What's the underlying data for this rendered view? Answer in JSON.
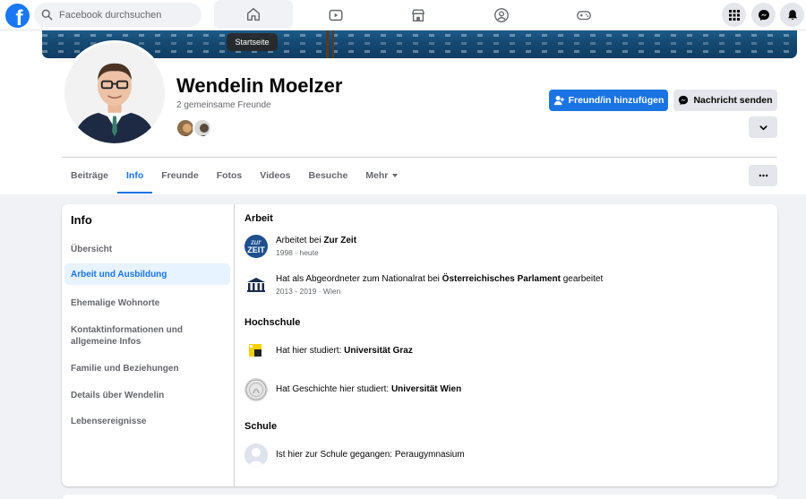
{
  "search": {
    "placeholder": "Facebook durchsuchen"
  },
  "nav": {
    "tooltip": "Startseite",
    "tabs": [
      {
        "icon": "home-icon"
      },
      {
        "icon": "watch-icon"
      },
      {
        "icon": "marketplace-icon"
      },
      {
        "icon": "groups-icon"
      },
      {
        "icon": "gaming-icon"
      }
    ],
    "right": [
      "menu-grid-icon",
      "messenger-icon",
      "notifications-icon"
    ]
  },
  "profile": {
    "name": "Wendelin Moelzer",
    "mutual_friends": "2 gemeinsame Freunde",
    "add_friend": "Freund/in hinzufügen",
    "send_message": "Nachricht senden"
  },
  "tabs": [
    {
      "label": "Beiträge"
    },
    {
      "label": "Info"
    },
    {
      "label": "Freunde"
    },
    {
      "label": "Fotos"
    },
    {
      "label": "Videos"
    },
    {
      "label": "Besuche"
    },
    {
      "label": "Mehr"
    }
  ],
  "sidebar": {
    "title": "Info",
    "items": [
      {
        "label": "Übersicht"
      },
      {
        "label": "Arbeit und Ausbildung"
      },
      {
        "label": "Ehemalige Wohnorte"
      },
      {
        "label": "Kontaktinformationen und allgemeine Infos"
      },
      {
        "label": "Familie und Beziehungen"
      },
      {
        "label": "Details über Wendelin"
      },
      {
        "label": "Lebensereignisse"
      }
    ]
  },
  "work": {
    "title": "Arbeit",
    "items": [
      {
        "prefix": "Arbeitet bei ",
        "org": "Zur Zeit",
        "suffix": "",
        "sub": "1998 - heute"
      },
      {
        "prefix": "Hat als Abgeordneter zum Nationalrat bei ",
        "org": "Österreichisches Parlament",
        "suffix": " gearbeitet",
        "sub": "2013 - 2019 · Wien"
      }
    ]
  },
  "college": {
    "title": "Hochschule",
    "items": [
      {
        "prefix": "Hat hier studiert: ",
        "org": "Universität Graz"
      },
      {
        "prefix": "Hat Geschichte hier studiert: ",
        "org": "Universität Wien"
      }
    ]
  },
  "school": {
    "title": "Schule",
    "items": [
      {
        "prefix": "Ist hier zur Schule gegangen: ",
        "org": "Peraugymnasium"
      }
    ]
  },
  "logos": {
    "zurzeit_line1": "zur",
    "zurzeit_line2": "ZEIT"
  },
  "colors": {
    "accent": "#1b74e4",
    "brand": "#1877f2"
  }
}
